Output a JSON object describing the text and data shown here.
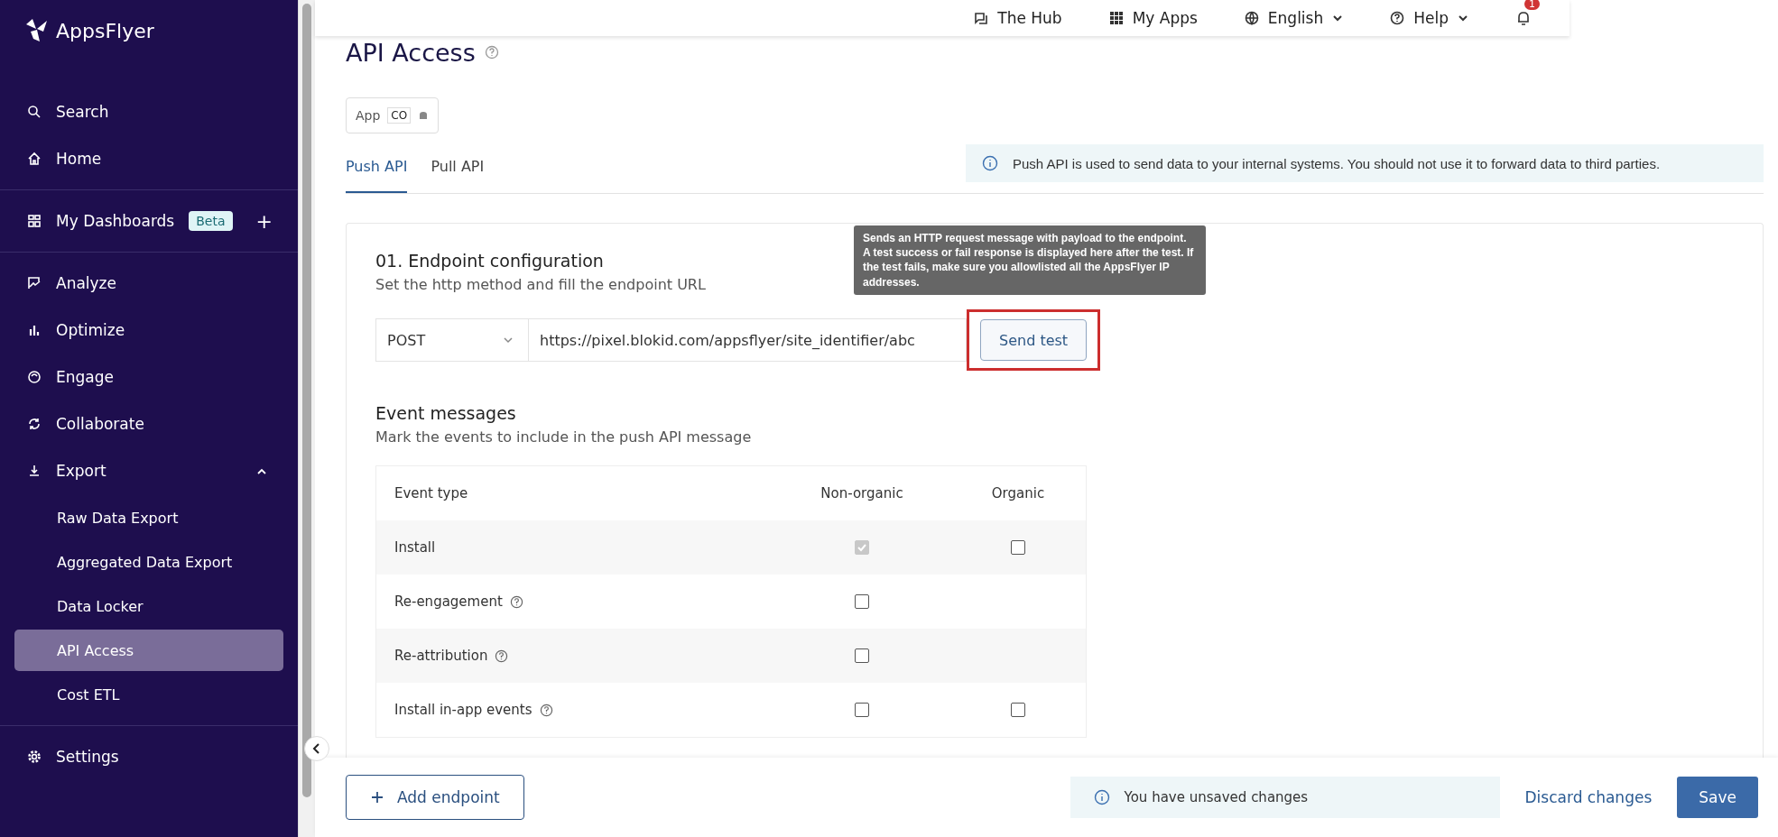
{
  "sidebar": {
    "logo": "AppsFlyer",
    "groups": [
      {
        "items": [
          {
            "label": "Search",
            "selected": false
          },
          {
            "label": "Home",
            "selected": false
          }
        ]
      },
      {
        "items": [
          {
            "label": "My Dashboards",
            "badge": "Beta",
            "add": "+",
            "selected": false
          }
        ]
      },
      {
        "items": [
          {
            "label": "Analyze",
            "selected": false
          },
          {
            "label": "Optimize",
            "selected": false
          },
          {
            "label": "Engage",
            "selected": false
          },
          {
            "label": "Collaborate",
            "selected": false
          },
          {
            "label": "Export",
            "selected": false,
            "expanded": true,
            "children": [
              {
                "label": "Raw Data Export",
                "selected": false
              },
              {
                "label": "Aggregated Data Export",
                "selected": false
              },
              {
                "label": "Data Locker",
                "selected": false
              },
              {
                "label": "API Access",
                "selected": true
              },
              {
                "label": "Cost ETL",
                "selected": false
              }
            ]
          }
        ]
      },
      {
        "items": [
          {
            "label": "Settings",
            "selected": false
          }
        ]
      }
    ]
  },
  "top_bar": {
    "items": [
      {
        "label": "The Hub",
        "dropdown": false
      },
      {
        "label": "My Apps",
        "dropdown": false
      },
      {
        "label": "English",
        "dropdown": true
      },
      {
        "label": "Help",
        "dropdown": true
      }
    ],
    "notifications": "1"
  },
  "page": {
    "title": "API Access",
    "app_label": "App",
    "app_value": "CO"
  },
  "tabs": [
    {
      "label": "Push API",
      "selected": true
    },
    {
      "label": "Pull API",
      "selected": false
    }
  ],
  "info_banner": "Push API is used to send data to your internal systems. You should not use it to forward data to third parties.",
  "endpoint": {
    "heading": "01. Endpoint configuration",
    "subtitle": "Set the http method and fill the endpoint URL",
    "method": "POST",
    "url": "https://pixel.blokid.com/appsflyer/site_identifier/abc",
    "send_button": "Send test",
    "highlighted": true,
    "tooltip": "Sends an HTTP request message with payload to the endpoint. A test success or fail response is displayed here after the test. If the test fails, make sure you allowlisted all the AppsFlyer IP addresses."
  },
  "events": {
    "heading": "Event messages",
    "subtitle": "Mark the events to include in the push API message",
    "columns": [
      "Event type",
      "Non-organic",
      "Organic"
    ],
    "rows": [
      {
        "name": "Install",
        "help": false,
        "non_organic": {
          "checked": true,
          "disabled": true
        },
        "organic": {
          "checked": false,
          "disabled": false
        }
      },
      {
        "name": "Re-engagement",
        "help": true,
        "non_organic": {
          "checked": false,
          "disabled": false
        }
      },
      {
        "name": "Re-attribution",
        "help": true,
        "non_organic": {
          "checked": false,
          "disabled": false
        }
      },
      {
        "name": "Install in-app events",
        "help": true,
        "non_organic": {
          "checked": false,
          "disabled": false
        },
        "organic": {
          "checked": false,
          "disabled": false
        }
      }
    ]
  },
  "footer": {
    "add_button": "Add endpoint",
    "unsaved": "You have unsaved changes",
    "discard": "Discard changes",
    "save": "Save"
  }
}
